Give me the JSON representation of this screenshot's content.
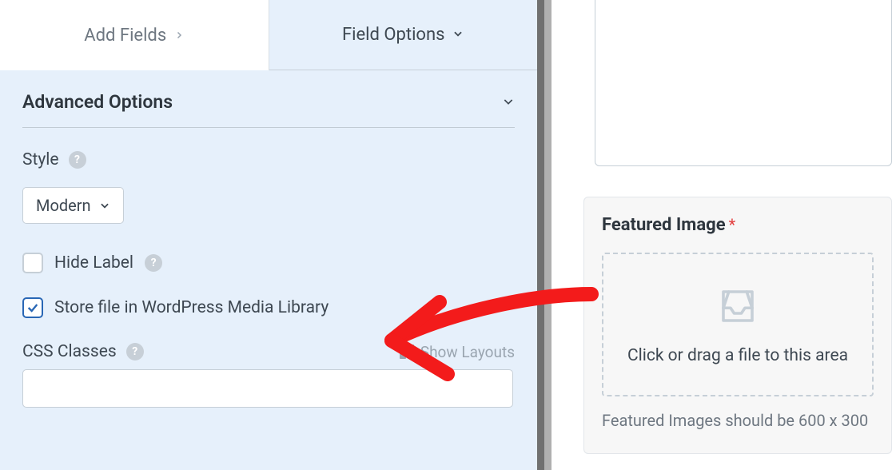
{
  "tabs": {
    "add_fields": "Add Fields",
    "field_options": "Field Options"
  },
  "accordion": {
    "advanced_options": "Advanced Options"
  },
  "style": {
    "label": "Style",
    "value": "Modern"
  },
  "hide_label": {
    "label": "Hide Label",
    "checked": false
  },
  "store_media": {
    "label": "Store file in WordPress Media Library",
    "checked": true
  },
  "css_classes": {
    "label": "CSS Classes",
    "value": ""
  },
  "show_layouts": "Show Layouts",
  "featured": {
    "title": "Featured Image",
    "dropzone_text": "Click or drag a file to this area",
    "note": "Featured Images should be 600 x 300"
  }
}
